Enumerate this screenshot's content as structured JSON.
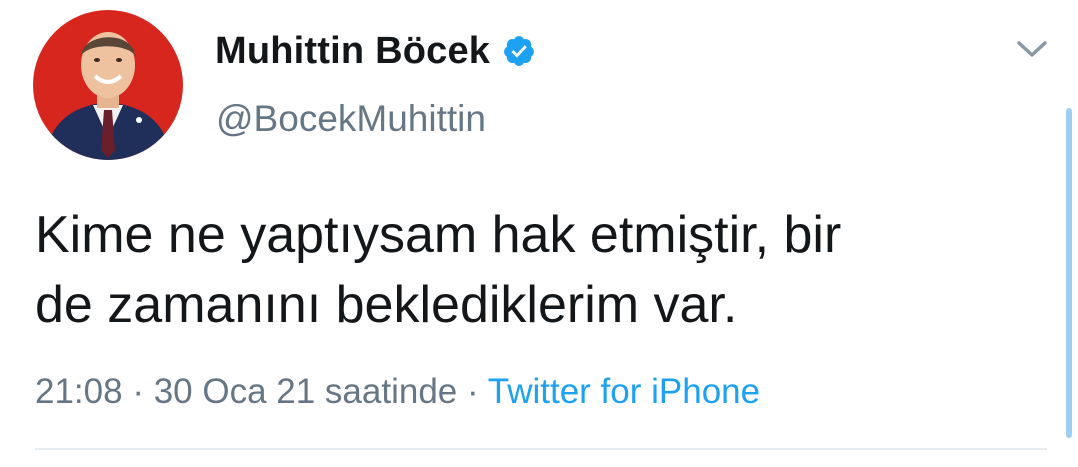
{
  "author": {
    "display_name": "Muhittin Böcek",
    "handle": "@BocekMuhittin",
    "verified": true
  },
  "tweet": {
    "text_lines": [
      "Kime ne yaptıysam hak etmiştir, bir",
      "de zamanını beklediklerim var."
    ],
    "time": "21:08",
    "separator": " · ",
    "date": "30 Oca 21 saatinde",
    "source": "Twitter for iPhone"
  },
  "icons": {
    "verified": "verified-badge-icon",
    "menu": "chevron-down-icon"
  },
  "colors": {
    "brand_blue": "#1da1f2",
    "muted_text": "#657786",
    "avatar_background": "#d7261e"
  }
}
